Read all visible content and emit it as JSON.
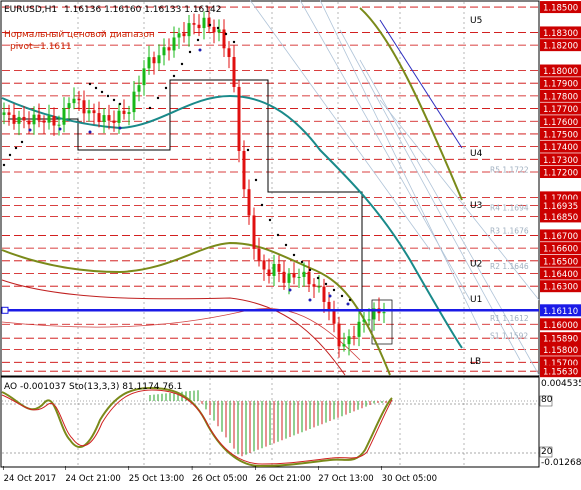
{
  "window": {
    "symbol_title": "EURUSD,H1",
    "ohlc": "1.16136 1.16160 1.16133 1.16142",
    "indicator_title": "Нормальный ценовой диапазон",
    "pivot_text": "pivot=1.1611"
  },
  "price_scale": [
    {
      "label": "1.18500",
      "value": 1.185
    },
    {
      "label": "1.18300",
      "value": 1.183
    },
    {
      "label": "1.18200",
      "value": 1.182
    },
    {
      "label": "1.18000",
      "value": 1.18
    },
    {
      "label": "1.17900",
      "value": 1.179
    },
    {
      "label": "1.17800",
      "value": 1.178
    },
    {
      "label": "1.17700",
      "value": 1.177
    },
    {
      "label": "1.17600",
      "value": 1.176
    },
    {
      "label": "1.17500",
      "value": 1.175
    },
    {
      "label": "1.17400",
      "value": 1.174
    },
    {
      "label": "1.17300",
      "value": 1.173
    },
    {
      "label": "1.17200",
      "value": 1.172
    },
    {
      "label": "1.17000",
      "value": 1.17
    },
    {
      "label": "1.16935",
      "value": 1.16935
    },
    {
      "label": "1.16850",
      "value": 1.1685
    },
    {
      "label": "1.16700",
      "value": 1.167
    },
    {
      "label": "1.16600",
      "value": 1.166
    },
    {
      "label": "1.16500",
      "value": 1.165
    },
    {
      "label": "1.16400",
      "value": 1.164
    },
    {
      "label": "1.16300",
      "value": 1.163
    },
    {
      "label": "1.16110",
      "value": 1.1611,
      "highlight": true
    },
    {
      "label": "1.16000",
      "value": 1.16
    },
    {
      "label": "1.15890",
      "value": 1.1589
    },
    {
      "label": "1.15800",
      "value": 1.158
    },
    {
      "label": "1.15700",
      "value": 1.157
    },
    {
      "label": "1.15630",
      "value": 1.1563
    }
  ],
  "pivot_labels": [
    {
      "text": "U5",
      "value": 1.184
    },
    {
      "text": "U4",
      "value": 1.1735
    },
    {
      "text": "U3",
      "value": 1.1694
    },
    {
      "text": "U2",
      "value": 1.1648
    },
    {
      "text": "U1",
      "value": 1.162
    },
    {
      "text": "LB",
      "value": 1.1571
    }
  ],
  "resistance_labels": [
    {
      "text": "R5 1.1722",
      "value": 1.1722
    },
    {
      "text": "R4 1.1694",
      "value": 1.1692
    },
    {
      "text": "R3 1.1676",
      "value": 1.1674
    },
    {
      "text": "R2 1.1646",
      "value": 1.1646
    },
    {
      "text": "R1 1.1612",
      "value": 1.1605
    },
    {
      "text": "S1 1.1592",
      "value": 1.1591
    }
  ],
  "time_axis": [
    {
      "label": "24 Oct 2017",
      "fraction": 0.003
    },
    {
      "label": "24 Oct 21:00",
      "fraction": 0.118
    },
    {
      "label": "25 Oct 13:00",
      "fraction": 0.236
    },
    {
      "label": "26 Oct 05:00",
      "fraction": 0.354
    },
    {
      "label": "26 Oct 21:00",
      "fraction": 0.472
    },
    {
      "label": "27 Oct 13:00",
      "fraction": 0.589
    },
    {
      "label": "30 Oct 05:00",
      "fraction": 0.707
    }
  ],
  "oscillator": {
    "title": "AO -0.001037  Sto(13,3,3) 81.1174 76.1",
    "scale_top": "0.004535",
    "scale_bottom": "-0.012685",
    "level_high": "80",
    "level_low": "20"
  },
  "colors": {
    "background": "#ffffff",
    "bull_candle": "#18b818",
    "bear_candle": "#e01010",
    "level_line": "#cc0000",
    "pivot_line": "#1a1ae6",
    "teal_ma": "#1a8a8a",
    "olive_ma": "#7a8a1a",
    "stoch_main": "#7a8a1a",
    "stoch_signal": "#d02020"
  }
}
